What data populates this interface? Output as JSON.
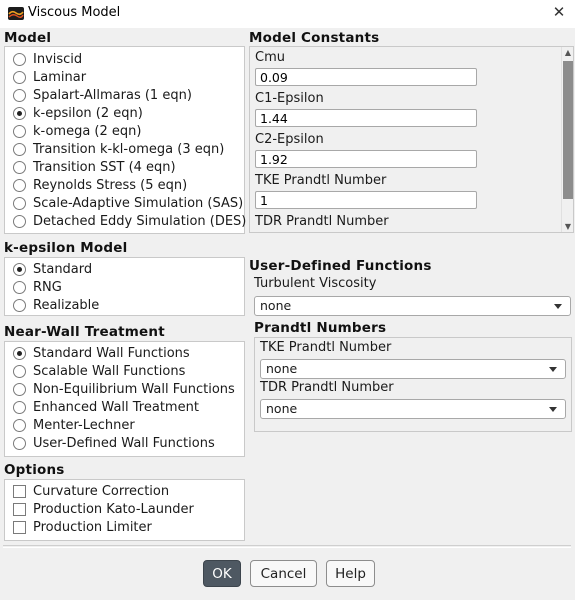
{
  "window": {
    "title": "Viscous Model",
    "close_symbol": "✕"
  },
  "model": {
    "title": "Model",
    "options": [
      {
        "label": "Inviscid",
        "selected": false
      },
      {
        "label": "Laminar",
        "selected": false
      },
      {
        "label": "Spalart-Allmaras (1 eqn)",
        "selected": false
      },
      {
        "label": "k-epsilon (2 eqn)",
        "selected": true
      },
      {
        "label": "k-omega (2 eqn)",
        "selected": false
      },
      {
        "label": "Transition k-kl-omega (3 eqn)",
        "selected": false
      },
      {
        "label": "Transition SST (4 eqn)",
        "selected": false
      },
      {
        "label": "Reynolds Stress (5 eqn)",
        "selected": false
      },
      {
        "label": "Scale-Adaptive Simulation (SAS)",
        "selected": false
      },
      {
        "label": "Detached Eddy Simulation (DES)",
        "selected": false
      }
    ]
  },
  "model_constants": {
    "title": "Model Constants",
    "fields": [
      {
        "label": "Cmu",
        "value": "0.09"
      },
      {
        "label": "C1-Epsilon",
        "value": "1.44"
      },
      {
        "label": "C2-Epsilon",
        "value": "1.92"
      },
      {
        "label": "TKE Prandtl Number",
        "value": "1"
      },
      {
        "label": "TDR Prandtl Number",
        "value": ""
      }
    ]
  },
  "k_epsilon_model": {
    "title": "k-epsilon Model",
    "options": [
      {
        "label": "Standard",
        "selected": true
      },
      {
        "label": "RNG",
        "selected": false
      },
      {
        "label": "Realizable",
        "selected": false
      }
    ]
  },
  "near_wall": {
    "title": "Near-Wall Treatment",
    "options": [
      {
        "label": "Standard Wall Functions",
        "selected": true
      },
      {
        "label": "Scalable Wall Functions",
        "selected": false
      },
      {
        "label": "Non-Equilibrium Wall Functions",
        "selected": false
      },
      {
        "label": "Enhanced Wall Treatment",
        "selected": false
      },
      {
        "label": "Menter-Lechner",
        "selected": false
      },
      {
        "label": "User-Defined Wall Functions",
        "selected": false
      }
    ]
  },
  "options": {
    "title": "Options",
    "items": [
      {
        "label": "Curvature Correction",
        "checked": false
      },
      {
        "label": "Production Kato-Launder",
        "checked": false
      },
      {
        "label": "Production Limiter",
        "checked": false
      }
    ]
  },
  "udf": {
    "title": "User-Defined Functions",
    "turbulent_viscosity_label": "Turbulent Viscosity",
    "turbulent_viscosity_value": "none",
    "prandtl_title": "Prandtl Numbers",
    "tke_label": "TKE Prandtl Number",
    "tke_value": "none",
    "tdr_label": "TDR Prandtl Number",
    "tdr_value": "none"
  },
  "buttons": {
    "ok": "OK",
    "cancel": "Cancel",
    "help": "Help"
  }
}
